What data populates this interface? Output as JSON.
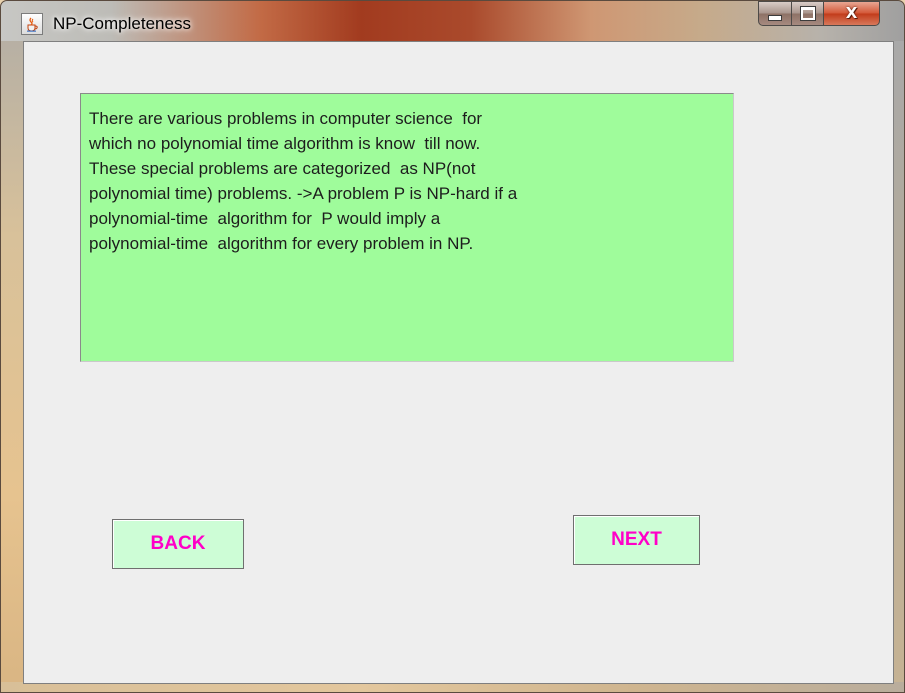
{
  "window": {
    "title": "NP-Completeness",
    "icon": "java-cup-icon",
    "controls": {
      "minimize": "minimize-icon",
      "maximize": "maximize-icon",
      "close_glyph": "X"
    }
  },
  "content": {
    "description": "There are various problems in computer science  for\nwhich no polynomial time algorithm is know  till now.\nThese special problems are categorized  as NP(not\npolynomial time) problems. ->A problem P is NP-hard if a\npolynomial-time  algorithm for  P would imply a\npolynomial-time  algorithm for every problem in NP."
  },
  "buttons": {
    "back_label": "BACK",
    "next_label": "NEXT"
  },
  "colors": {
    "text_area_bg": "#9ffc9b",
    "button_bg": "#cdfdd6",
    "button_text": "#ff00c8"
  }
}
